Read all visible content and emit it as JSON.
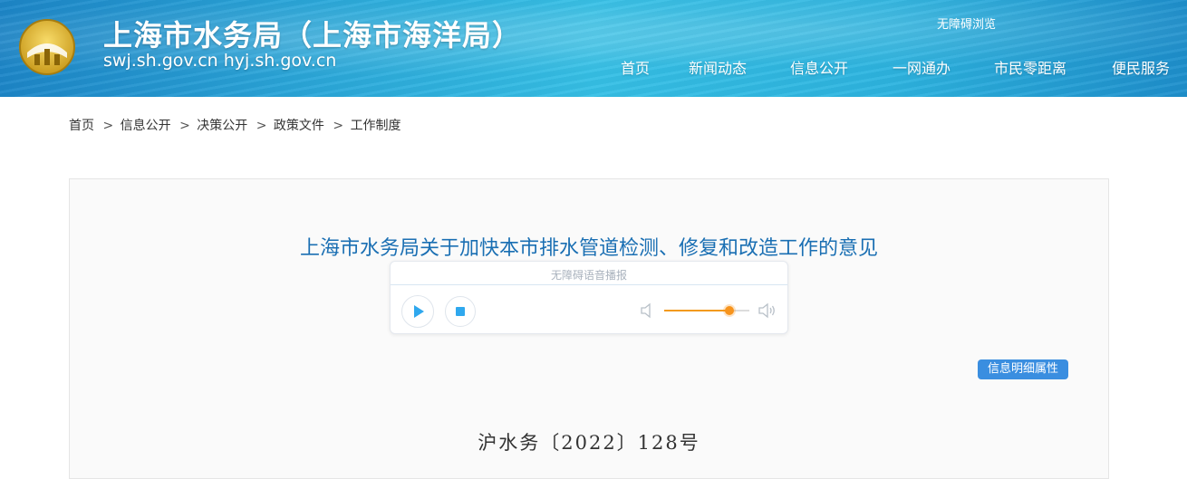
{
  "header": {
    "site_title": "上海市水务局（上海市海洋局）",
    "site_url": "swj.sh.gov.cn  hyj.sh.gov.cn",
    "accessibility_label": "无障碍浏览",
    "logo_icon": "shanghai-emblem-icon"
  },
  "nav": {
    "items": [
      {
        "label": "首页"
      },
      {
        "label": "新闻动态"
      },
      {
        "label": "信息公开"
      },
      {
        "label": "一网通办"
      },
      {
        "label": "市民零距离"
      },
      {
        "label": "便民服务"
      }
    ]
  },
  "breadcrumb": {
    "items": [
      {
        "label": "首页"
      },
      {
        "label": "信息公开"
      },
      {
        "label": "决策公开"
      },
      {
        "label": "政策文件"
      },
      {
        "label": "工作制度"
      }
    ],
    "separator": ">"
  },
  "article": {
    "title": "上海市水务局关于加快本市排水管道检测、修复和改造工作的意见",
    "doc_number": "沪水务〔2022〕128号"
  },
  "player": {
    "label": "无障碍语音播报",
    "play_icon": "play-icon",
    "stop_icon": "stop-icon",
    "volume_low_icon": "volume-low-icon",
    "volume_high_icon": "volume-high-icon",
    "volume_level": 0.77
  },
  "properties_button": {
    "label": "信息明细属性"
  },
  "colors": {
    "title_blue": "#1a6fb3",
    "button_blue": "#3a8ee0",
    "volume_orange": "#f7941d",
    "play_blue": "#2fa8ee"
  }
}
